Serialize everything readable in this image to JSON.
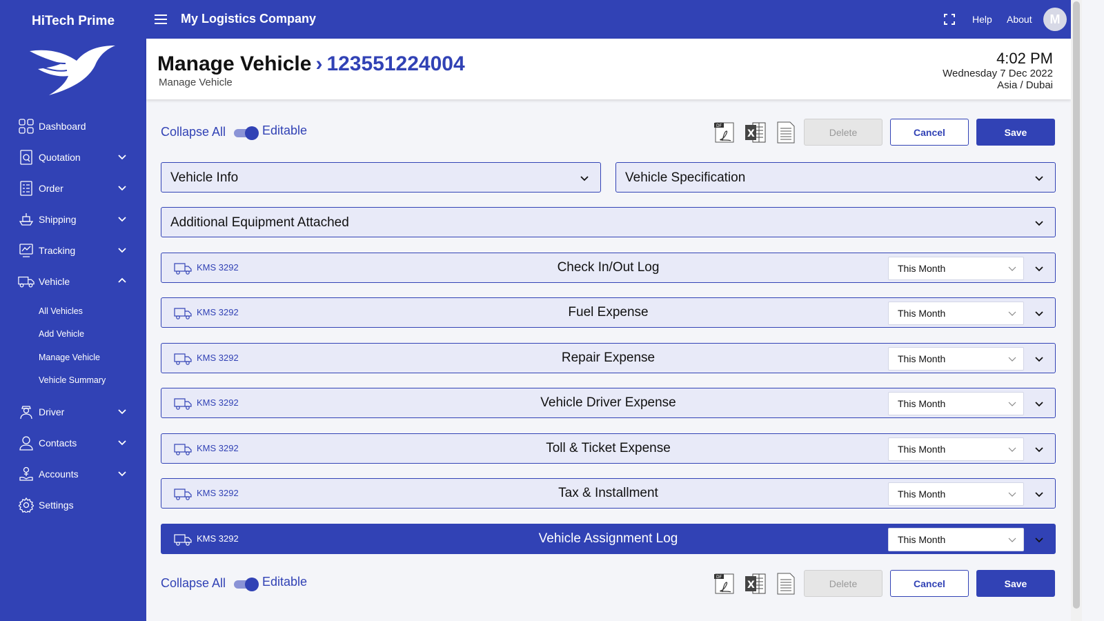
{
  "brand": "HiTech Prime",
  "topbar": {
    "company": "My Logistics Company",
    "help": "Help",
    "about": "About",
    "avatar_initial": "M"
  },
  "sidebar": {
    "items": [
      {
        "label": "Dashboard",
        "icon": "dashboard-icon"
      },
      {
        "label": "Quotation",
        "icon": "quotation-icon"
      },
      {
        "label": "Order",
        "icon": "order-icon"
      },
      {
        "label": "Shipping",
        "icon": "shipping-icon"
      },
      {
        "label": "Tracking",
        "icon": "tracking-icon"
      },
      {
        "label": "Vehicle",
        "icon": "vehicle-icon"
      },
      {
        "label": "Driver",
        "icon": "driver-icon"
      },
      {
        "label": "Contacts",
        "icon": "contacts-icon"
      },
      {
        "label": "Accounts",
        "icon": "accounts-icon"
      },
      {
        "label": "Settings",
        "icon": "settings-icon"
      }
    ],
    "vehicle_sub": [
      "All Vehicles",
      "Add Vehicle",
      "Manage Vehicle",
      "Vehicle Summary"
    ]
  },
  "header": {
    "title": "Manage Vehicle",
    "separator": "›",
    "vehicle_id": "123551224004",
    "subtitle": "Manage Vehicle",
    "time": "4:02 PM",
    "date": "Wednesday 7 Dec 2022",
    "timezone": "Asia / Dubai"
  },
  "toolbar": {
    "collapse_all": "Collapse All",
    "editable": "Editable",
    "delete": "Delete",
    "cancel": "Cancel",
    "save": "Save"
  },
  "panels": {
    "vehicle_info": "Vehicle Info",
    "vehicle_spec": "Vehicle Specification",
    "additional_equipment": "Additional Equipment Attached"
  },
  "logs": [
    {
      "plate": "KMS 3292",
      "title": "Check In/Out Log",
      "period": "This Month"
    },
    {
      "plate": "KMS 3292",
      "title": "Fuel Expense",
      "period": "This Month"
    },
    {
      "plate": "KMS 3292",
      "title": "Repair Expense",
      "period": "This Month"
    },
    {
      "plate": "KMS 3292",
      "title": "Vehicle Driver Expense",
      "period": "This Month"
    },
    {
      "plate": "KMS 3292",
      "title": "Toll & Ticket Expense",
      "period": "This Month"
    },
    {
      "plate": "KMS 3292",
      "title": "Tax & Installment",
      "period": "This Month"
    },
    {
      "plate": "KMS 3292",
      "title": "Vehicle Assignment Log",
      "period": "This Month"
    }
  ],
  "colors": {
    "primary": "#3142b5",
    "panel_bg": "#e8eaf8",
    "disabled": "#e6e6e6"
  }
}
